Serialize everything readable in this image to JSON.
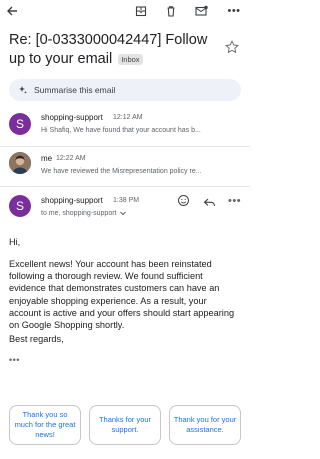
{
  "header": {
    "back_icon": "back-arrow-icon",
    "archive_icon": "archive-icon",
    "delete_icon": "trash-icon",
    "mark_unread_icon": "mail-icon",
    "more_icon": "more-vertical-icon"
  },
  "subject": {
    "text": "Re: [0-0333000042447] Follow up to your email",
    "label": "Inbox"
  },
  "summarise": {
    "label": "Summarise this email",
    "icon": "sparkle-icon"
  },
  "thread": [
    {
      "avatar_letter": "S",
      "sender": "shopping-support",
      "time": "12:12 AM",
      "snippet": "Hi Shafiq, We have found that your account has b..."
    },
    {
      "avatar_letter": "",
      "sender": "me",
      "time": "12:22 AM",
      "snippet": "We have reviewed the Misrepresentation policy re..."
    }
  ],
  "open_message": {
    "avatar_letter": "S",
    "sender": "shopping-support",
    "time": "1:38 PM",
    "recipient": "to me, shopping-support",
    "greeting": "Hi,",
    "body": "Excellent news! Your account has been reinstated following a thorough review. We found sufficient evidence that demonstrates customers can have an enjoyable shopping experience. As a result, your account is active and your offers should start appearing on Google Shopping shortly.",
    "closing": "Best regards,",
    "ellipsis": "•••"
  },
  "smart_replies": [
    "Thank you so much for the great news!",
    "Thanks for your support.",
    "Thank you for your assistance."
  ],
  "colors": {
    "avatar": "#7a2e9c",
    "accent": "#1a73e8",
    "summarise_bg": "#eef1f8"
  }
}
